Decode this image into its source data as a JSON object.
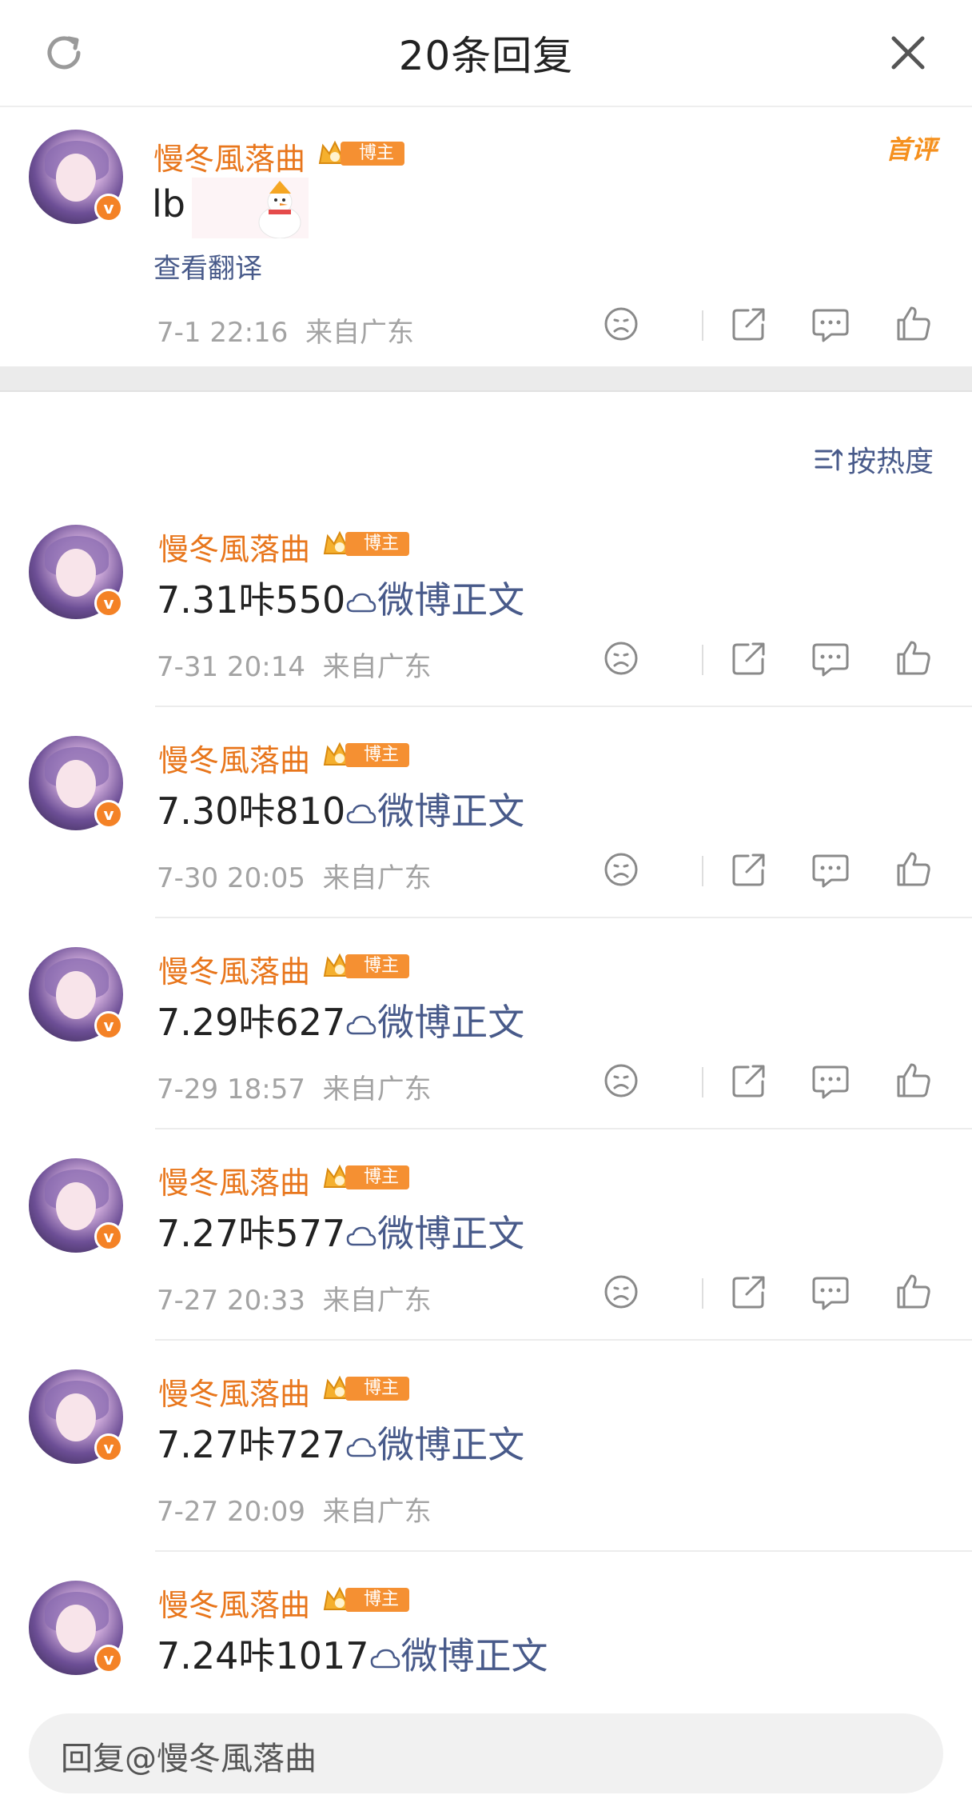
{
  "header": {
    "title": "20条回复"
  },
  "main_comment": {
    "username": "慢冬風落曲",
    "badge": "博主",
    "first_tag": "首评",
    "text": "lb",
    "translate_label": "查看翻译",
    "time": "7-1 22:16",
    "location": "来自广东"
  },
  "sort": {
    "label": "按热度"
  },
  "replies": [
    {
      "username": "慢冬風落曲",
      "badge": "博主",
      "text": "7.31咔550",
      "link": "微博正文",
      "time": "7-31 20:14",
      "location": "来自广东"
    },
    {
      "username": "慢冬風落曲",
      "badge": "博主",
      "text": "7.30咔810",
      "link": "微博正文",
      "time": "7-30 20:05",
      "location": "来自广东"
    },
    {
      "username": "慢冬風落曲",
      "badge": "博主",
      "text": "7.29咔627",
      "link": "微博正文",
      "time": "7-29 18:57",
      "location": "来自广东"
    },
    {
      "username": "慢冬風落曲",
      "badge": "博主",
      "text": "7.27咔577",
      "link": "微博正文",
      "time": "7-27 20:33",
      "location": "来自广东"
    },
    {
      "username": "慢冬風落曲",
      "badge": "博主",
      "text": "7.27咔727",
      "link": "微博正文",
      "time": "7-27 20:09",
      "location": "来自广东"
    },
    {
      "username": "慢冬風落曲",
      "badge": "博主",
      "text": "7.24咔1017",
      "link": "微博正文"
    }
  ],
  "reply_input": {
    "placeholder": "回复@慢冬風落曲"
  },
  "icons": {
    "refresh": "refresh-icon",
    "close": "close-icon",
    "dislike": "sad-face-icon",
    "share": "share-icon",
    "comment": "comment-icon",
    "like": "thumbs-up-icon",
    "sort": "sort-icon",
    "link": "cloud-link-icon"
  },
  "colors": {
    "username": "#e8761c",
    "link": "#485a8a",
    "meta": "#a3a3a3",
    "badge": "#f59032"
  }
}
